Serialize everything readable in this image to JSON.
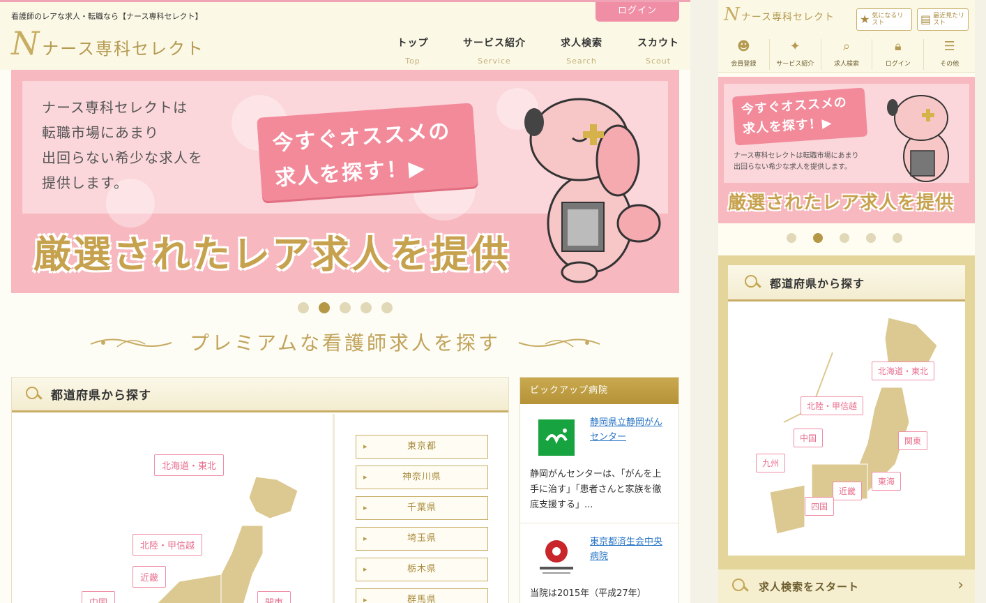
{
  "header": {
    "tagline": "看護師のレアな求人・転職なら【ナース専科セレクト】",
    "login": "ログイン",
    "logo_mark": "N",
    "logo_text": "ナース専科セレクト",
    "nav": [
      {
        "jp": "トップ",
        "en": "Top"
      },
      {
        "jp": "サービス紹介",
        "en": "Service"
      },
      {
        "jp": "求人検索",
        "en": "Search"
      },
      {
        "jp": "スカウト",
        "en": "Scout"
      }
    ]
  },
  "hero": {
    "lines": [
      "ナース専科セレクトは",
      "転職市場にあまり",
      "出回らない希少な求人を",
      "提供します。"
    ],
    "cta_line1": "今すぐオススメの",
    "cta_line2": "求人を探す！▶",
    "headline": "厳選されたレア求人を提供",
    "slides": 5,
    "active_slide": 2
  },
  "section": {
    "title": "プレミアムな看護師求人を探す"
  },
  "prefecture": {
    "title": "都道府県から探す",
    "regions": [
      "北海道・東北",
      "北陸・甲信越",
      "近畿",
      "中国",
      "関東"
    ],
    "prefs": [
      "東京都",
      "神奈川県",
      "千葉県",
      "埼玉県",
      "栃木県",
      "群馬県"
    ]
  },
  "pickup": {
    "title": "ピックアップ病院",
    "items": [
      {
        "name": "静岡県立静岡がんセンター",
        "desc": "静岡がんセンターは、「がんを上手に治す」「患者さんと家族を徹底支援する」..."
      },
      {
        "name": "東京都済生会中央病院",
        "desc": "当院は2015年（平成27年）"
      }
    ]
  },
  "mobile": {
    "logo_text": "ナース専科セレクト",
    "fav_btn": "気になるリスト",
    "recent_btn": "最近見たリスト",
    "nav": [
      "会員登録",
      "サービス紹介",
      "求人検索",
      "ログイン",
      "その他"
    ],
    "cta_line1": "今すぐオススメの",
    "cta_line2": "求人を探す！▶",
    "small_line1": "ナース専科セレクトは転職市場にあまり",
    "small_line2": "出回らない希少な求人を提供します。",
    "headline": "厳選されたレア求人を提供",
    "pref_title": "都道府県から探す",
    "regions": [
      "北海道・東北",
      "北陸・甲信越",
      "中国",
      "関東",
      "九州",
      "近畿",
      "東海",
      "四国"
    ],
    "start": "求人検索をスタート"
  },
  "colors": {
    "gold": "#c7ad66",
    "pink": "#f08ea6",
    "hero_pink": "#f7b8c0",
    "link": "#2a76c6"
  }
}
